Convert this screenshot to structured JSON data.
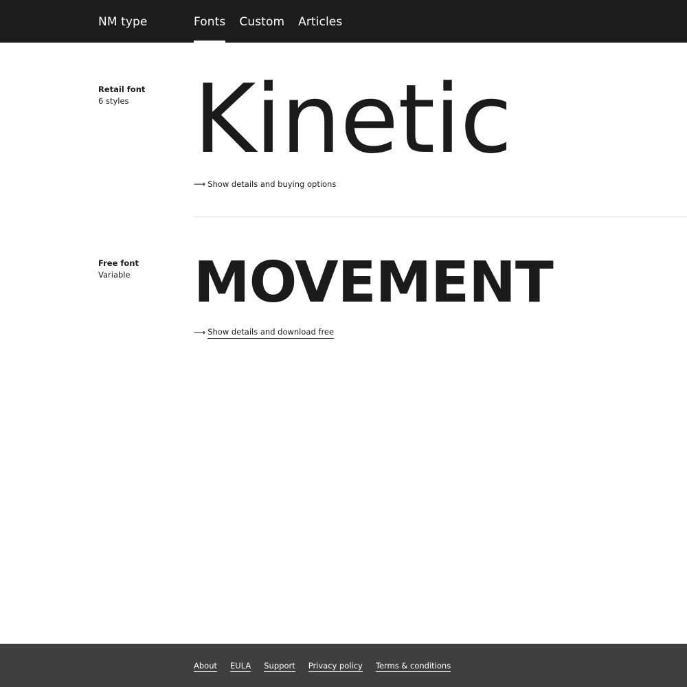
{
  "header": {
    "brand": "NM type",
    "nav": [
      {
        "label": "Fonts",
        "active": true
      },
      {
        "label": "Custom",
        "active": false
      },
      {
        "label": "Articles",
        "active": false
      }
    ]
  },
  "fonts": [
    {
      "kind": "Retail font",
      "styles": "6 styles",
      "specimen": "Kinetic",
      "cta": "Show details and buying options",
      "arrow": "⟶"
    },
    {
      "kind": "Free font",
      "styles": "Variable",
      "specimen": "MOVEMENT",
      "cta": "Show details and download free",
      "arrow": "⟶"
    }
  ],
  "footer": {
    "links": [
      "About",
      "EULA",
      "Support",
      "Privacy policy",
      "Terms & conditions"
    ]
  },
  "colors": {
    "header_bg": "#1d1d1d",
    "footer_bg": "#3f3f3f",
    "text": "#1b1b1b",
    "divider": "#e4e4e4"
  }
}
